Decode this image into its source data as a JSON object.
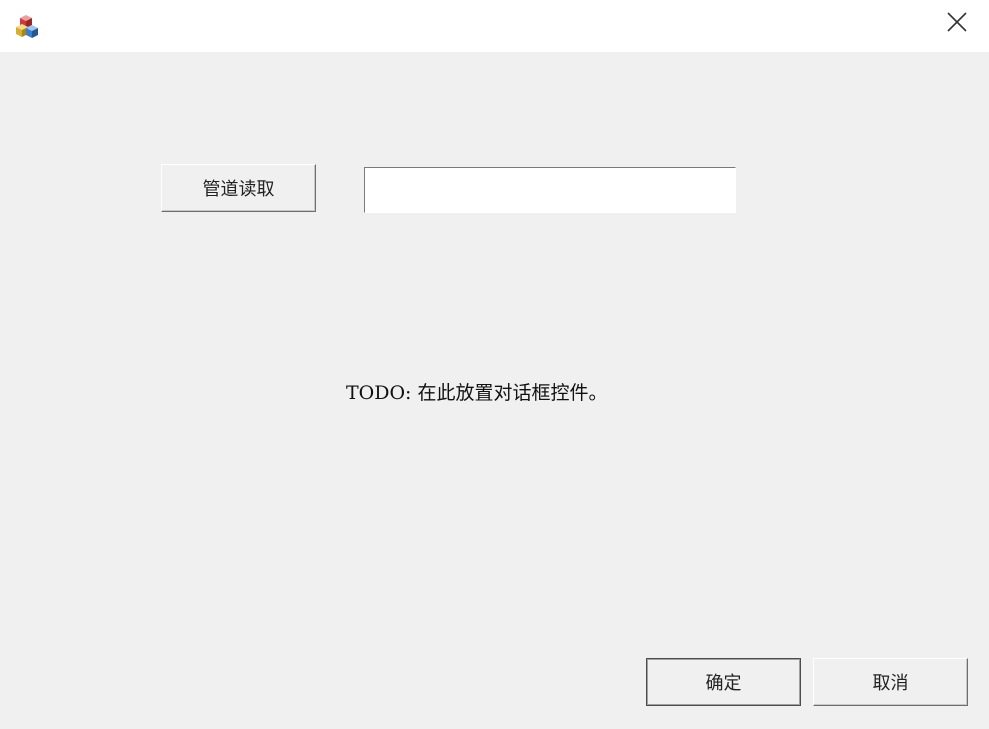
{
  "window": {
    "close_symbol": "✕",
    "icon": "app-cubes-icon"
  },
  "dialog": {
    "pipe_read_label": "管道读取",
    "input_value": "",
    "todo_text": "TODO: 在此放置对话框控件。",
    "ok_label": "确定",
    "cancel_label": "取消"
  }
}
